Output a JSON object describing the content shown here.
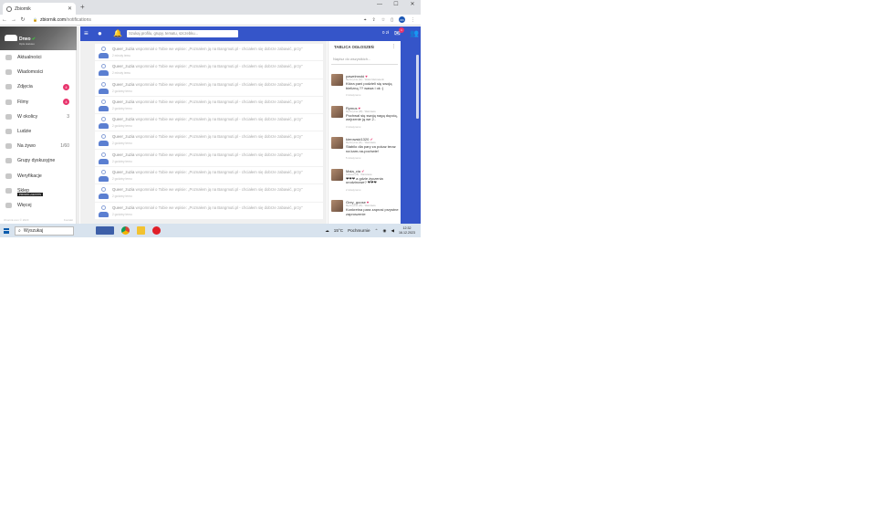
{
  "browser": {
    "tab_title": "Zbiornik",
    "url_host": "zbiornik.com",
    "url_path": "/notifications",
    "account_initials": "DN"
  },
  "sidebar": {
    "profile_name": "Drwo",
    "profile_status": "Opis statusu",
    "items": [
      {
        "label": "Aktualności"
      },
      {
        "label": "Wiadomości"
      },
      {
        "label": "Zdjęcia",
        "badge": "4"
      },
      {
        "label": "Filmy",
        "badge": "4"
      },
      {
        "label": "W okolicy",
        "count": "3"
      },
      {
        "label": "Ludzie"
      },
      {
        "label": "Na żywo",
        "count": "1/60"
      },
      {
        "label": "Grupy dyskusyjne"
      },
      {
        "label": "Weryfikacje"
      },
      {
        "label": "Sklep",
        "tag": "PROMO+GRATIS"
      },
      {
        "label": "Więcej"
      }
    ],
    "footer_left": "zbiornik.com © 2023",
    "footer_right": "Kontakt"
  },
  "appbar": {
    "search_placeholder": "Szukaj profilu, grupy, tematu, szczebku...",
    "coins": "0 zł",
    "mail_badge": "1"
  },
  "notifications": {
    "items": [
      {
        "user": "Queer_zuzia",
        "text": " wspomniał o Tobie we wpisie: „Poznałem ją na Bangmuti.pl - chciałem się dobrze zabawić, przy\"",
        "ago": "2 minuty temu"
      },
      {
        "user": "Queer_zuzia",
        "text": " wspomniał o Tobie we wpisie: „Poznałem ją na Bangmuti.pl - chciałem się dobrze zabawić, przy\"",
        "ago": "2 minuty temu"
      },
      {
        "user": "Queer_zuzia",
        "text": " wspomniał o Tobie we wpisie: „Poznałem ją na Bangmuti.pl - chciałem się dobrze zabawić, przy\"",
        "ago": "2 godziny temu"
      },
      {
        "user": "Queer_zuzia",
        "text": " wspomniał o Tobie we wpisie: „Poznałem ją na Bangmuti.pl - chciałem się dobrze zabawić, przy\"",
        "ago": "2 godziny temu"
      },
      {
        "user": "Queer_zuzia",
        "text": " wspomniał o Tobie we wpisie: „Poznałem ją na Bangmuti.pl - chciałem się dobrze zabawić, przy\"",
        "ago": "2 godziny temu"
      },
      {
        "user": "Queer_zuzia",
        "text": " wspomniał o Tobie we wpisie: „Poznałem ją na Bangmuti.pl - chciałem się dobrze zabawić, przy\"",
        "ago": "2 godziny temu"
      },
      {
        "user": "Queer_zuzia",
        "text": " wspomniał o Tobie we wpisie: „Poznałem ją na Bangmuti.pl - chciałem się dobrze zabawić, przy\"",
        "ago": "2 godziny temu"
      },
      {
        "user": "Queer_zuzia",
        "text": " wspomniał o Tobie we wpisie: „Poznałem ją na Bangmuti.pl - chciałem się dobrze zabawić, przy\"",
        "ago": "2 godziny temu"
      },
      {
        "user": "Queer_zuzia",
        "text": " wspomniał o Tobie we wpisie: „Poznałem ją na Bangmuti.pl - chciałem się dobrze zabawić, przy\"",
        "ago": "2 godziny temu"
      },
      {
        "user": "Queer_zuzia",
        "text": " wspomniał o Tobie we wpisie: „Poznałem ją na Bangmuti.pl - chciałem się dobrze zabawić, przy\"",
        "ago": "2 godziny temu"
      }
    ]
  },
  "board": {
    "title": "TABLICA OGŁOSZEŃ",
    "input_placeholder": "Napisz do wszystkich...",
    "posts": [
      {
        "name": "pawelmroki",
        "heart": "♥",
        "meta": "Mężczyzna (42) · Wolsk Mazowiecki",
        "body": "Która pani podzieli się swoją bielizną ?? wawa i ok :)",
        "time": "3 minuty temu"
      },
      {
        "name": "Rymus",
        "heart": "♥",
        "meta": "Mężczyzna (48) · Warszawa",
        "body": "Pochwal się swoją nagą dupcią, wejrzenie ją we 2..",
        "time": "3 minuty temu"
      },
      {
        "name": "kierowski1320",
        "heart": "✔",
        "meta": "Mężczyzna (41) · Warszawa",
        "body": "Stabilo dla pary za pokaz teraz na kam-na-pochwie!",
        "time": "5 minuty temu"
      },
      {
        "name": "Mala_cia",
        "heart": "✔",
        "meta": "Kobieta (28) · Warszawa",
        "body": "❤❤❤ a gdzie życzenia urodzinowe? ❤❤❤",
        "time": "2 minuty temu"
      },
      {
        "name": "Grey_goose",
        "heart": "♥",
        "meta": "Mężczyzna (46) · Warszawa",
        "body": "Konkretna para zaprosi przystne zaproszenie",
        "time": ""
      }
    ]
  },
  "taskbar": {
    "search_label": "Wyszukaj",
    "weather": "15°C",
    "weather_desc": "Pochmurnie",
    "time": "12:32",
    "date": "16.12.2023"
  },
  "colors": {
    "brand_blue": "#3555c9",
    "badge_pink": "#e8356d"
  }
}
